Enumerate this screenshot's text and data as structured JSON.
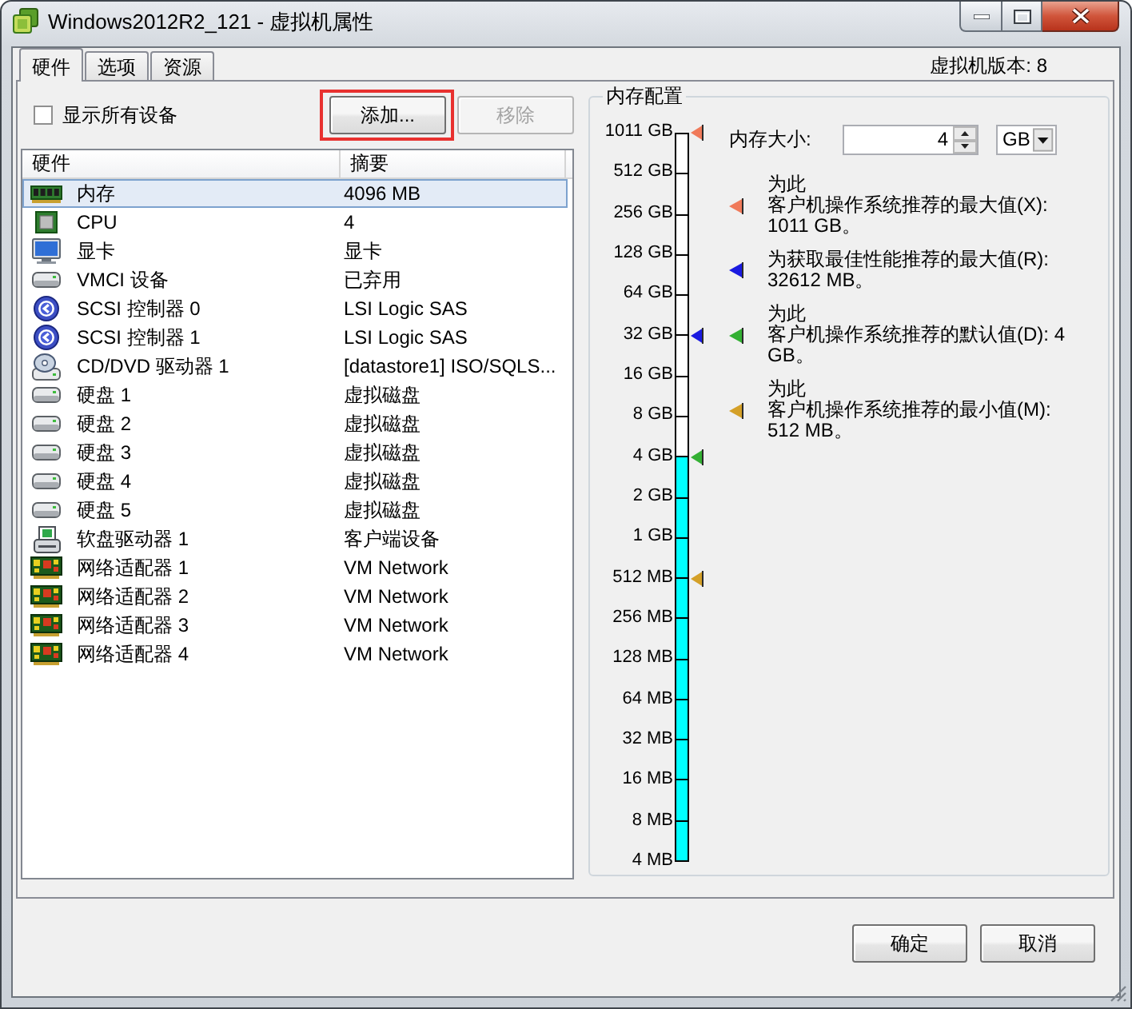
{
  "window": {
    "title": "Windows2012R2_121 - 虚拟机属性"
  },
  "tabs": [
    {
      "label": "硬件",
      "selected": true
    },
    {
      "label": "选项",
      "selected": false
    },
    {
      "label": "资源",
      "selected": false
    }
  ],
  "vm_version": "虚拟机版本: 8",
  "hardware": {
    "show_all_devices": {
      "label": "显示所有设备",
      "checked": false
    },
    "buttons": [
      {
        "label": "添加...",
        "disabled": false,
        "highlighted": true
      },
      {
        "label": "移除",
        "disabled": true,
        "highlighted": false
      }
    ],
    "columns": [
      "硬件",
      "摘要"
    ],
    "rows": [
      {
        "kind": "memory",
        "name": "内存",
        "summary": "4096 MB",
        "selected": true
      },
      {
        "kind": "cpu",
        "name": "CPU",
        "summary": "4",
        "selected": false
      },
      {
        "kind": "display",
        "name": "显卡",
        "summary": "显卡",
        "selected": false
      },
      {
        "kind": "vmci",
        "name": "VMCI 设备",
        "summary": "已弃用",
        "selected": false
      },
      {
        "kind": "scsi",
        "name": "SCSI 控制器 0",
        "summary": "LSI Logic SAS",
        "selected": false
      },
      {
        "kind": "scsi",
        "name": "SCSI 控制器 1",
        "summary": "LSI Logic SAS",
        "selected": false
      },
      {
        "kind": "cdrom",
        "name": "CD/DVD 驱动器 1",
        "summary": "[datastore1] ISO/SQLS...",
        "selected": false
      },
      {
        "kind": "disk",
        "name": "硬盘 1",
        "summary": "虚拟磁盘",
        "selected": false
      },
      {
        "kind": "disk",
        "name": "硬盘 2",
        "summary": "虚拟磁盘",
        "selected": false
      },
      {
        "kind": "disk",
        "name": "硬盘 3",
        "summary": "虚拟磁盘",
        "selected": false
      },
      {
        "kind": "disk",
        "name": "硬盘 4",
        "summary": "虚拟磁盘",
        "selected": false
      },
      {
        "kind": "disk",
        "name": "硬盘 5",
        "summary": "虚拟磁盘",
        "selected": false
      },
      {
        "kind": "floppy",
        "name": "软盘驱动器 1",
        "summary": "客户端设备",
        "selected": false
      },
      {
        "kind": "nic",
        "name": "网络适配器 1",
        "summary": "VM Network",
        "selected": false
      },
      {
        "kind": "nic",
        "name": "网络适配器 2",
        "summary": "VM Network",
        "selected": false
      },
      {
        "kind": "nic",
        "name": "网络适配器 3",
        "summary": "VM Network",
        "selected": false
      },
      {
        "kind": "nic",
        "name": "网络适配器 4",
        "summary": "VM Network",
        "selected": false
      }
    ]
  },
  "memory": {
    "title": "内存配置",
    "size": {
      "label": "内存大小:",
      "value": "4",
      "unit": "GB"
    },
    "scale": {
      "level": 0.556,
      "ticks": [
        {
          "label": "1011 GB",
          "color": "#f07a5a"
        },
        {
          "label": "512 GB"
        },
        {
          "label": "256 GB"
        },
        {
          "label": "128 GB"
        },
        {
          "label": "64 GB"
        },
        {
          "label": "32 GB",
          "color": "#1a1ae0"
        },
        {
          "label": "16 GB"
        },
        {
          "label": "8 GB"
        },
        {
          "label": "4 GB",
          "color": "#33b033"
        },
        {
          "label": "2 GB"
        },
        {
          "label": "1 GB"
        },
        {
          "label": "512 MB",
          "color": "#d4a028"
        },
        {
          "label": "256 MB"
        },
        {
          "label": "128 MB"
        },
        {
          "label": "64 MB"
        },
        {
          "label": "32 MB"
        },
        {
          "label": "16 MB"
        },
        {
          "label": "8 MB"
        },
        {
          "label": "4 MB"
        }
      ]
    },
    "recommendations": [
      {
        "color": "#f07a5a",
        "lines": [
          "为此",
          "客户机操作系统推荐的最大值(X):",
          "1011 GB。"
        ]
      },
      {
        "color": "#1a1ae0",
        "lines": [
          "为获取最佳性能推荐的最大值(R):",
          "32612 MB。"
        ]
      },
      {
        "color": "#33b033",
        "lines": [
          "为此",
          "客户机操作系统推荐的默认值(D): 4",
          "GB。"
        ]
      },
      {
        "color": "#d4a028",
        "lines": [
          "为此",
          "客户机操作系统推荐的最小值(M):",
          "512 MB。"
        ]
      }
    ]
  },
  "buttons": [
    {
      "label": "确定"
    },
    {
      "label": "取消"
    }
  ]
}
